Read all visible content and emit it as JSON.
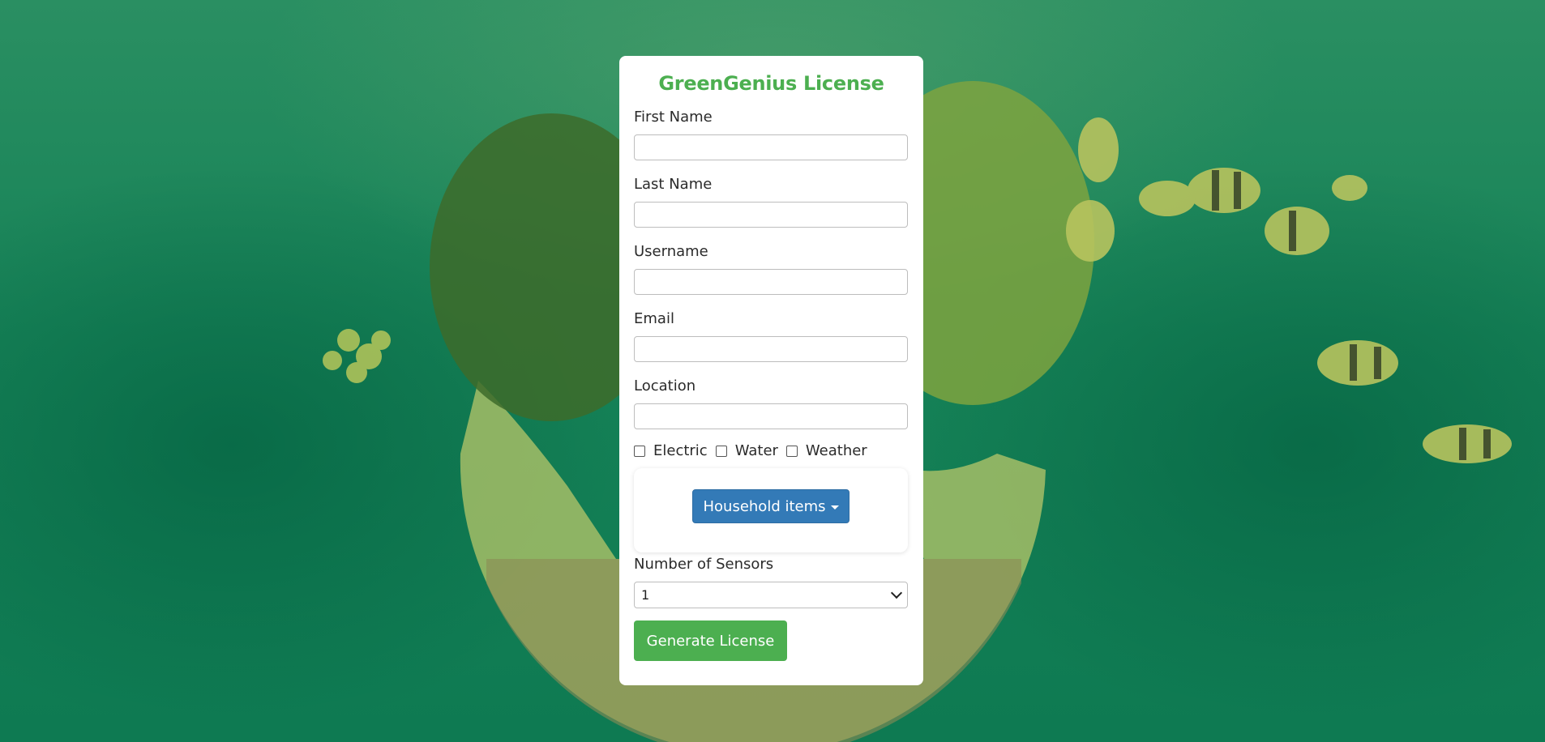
{
  "form": {
    "title": "GreenGenius License",
    "fields": [
      {
        "label": "First Name",
        "value": ""
      },
      {
        "label": "Last Name",
        "value": ""
      },
      {
        "label": "Username",
        "value": ""
      },
      {
        "label": "Email",
        "value": ""
      },
      {
        "label": "Location",
        "value": ""
      }
    ],
    "checkboxes": [
      {
        "label": "Electric",
        "checked": false
      },
      {
        "label": "Water",
        "checked": false
      },
      {
        "label": "Weather",
        "checked": false
      }
    ],
    "dropdown_button": "Household items",
    "sensors_label": "Number of Sensors",
    "sensors_value": "1",
    "submit": "Generate License"
  },
  "colors": {
    "title": "#4caf50",
    "submit": "#4caf50",
    "dropdown": "#337ab7"
  }
}
